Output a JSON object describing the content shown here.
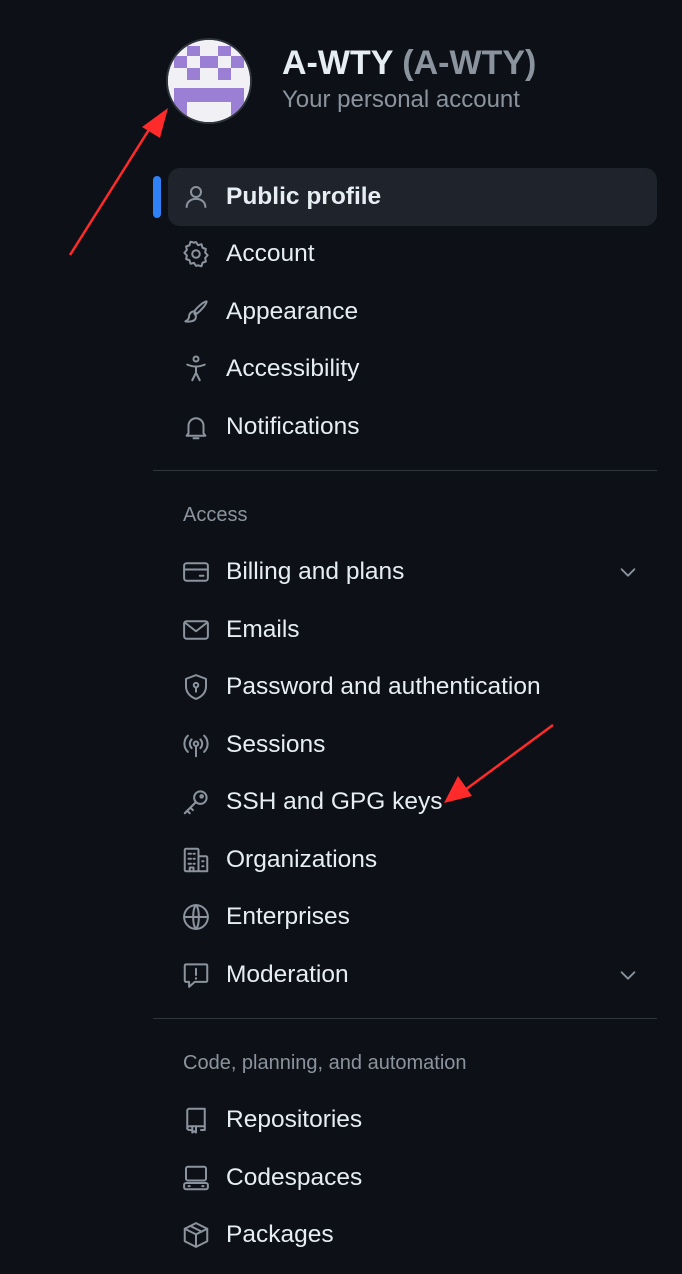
{
  "header": {
    "display_name": "A-WTY",
    "login": "(A-WTY)",
    "subtitle": "Your personal account"
  },
  "nav": {
    "top_items": [
      {
        "label": "Public profile",
        "icon": "person-icon",
        "active": true
      },
      {
        "label": "Account",
        "icon": "gear-icon"
      },
      {
        "label": "Appearance",
        "icon": "paintbrush-icon"
      },
      {
        "label": "Accessibility",
        "icon": "accessibility-icon"
      },
      {
        "label": "Notifications",
        "icon": "bell-icon"
      }
    ],
    "access_heading": "Access",
    "access_items": [
      {
        "label": "Billing and plans",
        "icon": "credit-card-icon",
        "expandable": true
      },
      {
        "label": "Emails",
        "icon": "mail-icon"
      },
      {
        "label": "Password and authentication",
        "icon": "shield-lock-icon"
      },
      {
        "label": "Sessions",
        "icon": "broadcast-icon"
      },
      {
        "label": "SSH and GPG keys",
        "icon": "key-icon"
      },
      {
        "label": "Organizations",
        "icon": "organization-icon"
      },
      {
        "label": "Enterprises",
        "icon": "globe-icon"
      },
      {
        "label": "Moderation",
        "icon": "report-icon",
        "expandable": true
      }
    ],
    "code_heading": "Code, planning, and automation",
    "code_items": [
      {
        "label": "Repositories",
        "icon": "repo-icon"
      },
      {
        "label": "Codespaces",
        "icon": "codespaces-icon"
      },
      {
        "label": "Packages",
        "icon": "package-icon"
      }
    ]
  },
  "colors": {
    "background": "#0d1117",
    "active_bar": "#2f81f7",
    "avatar_purple": "#9b7fd4",
    "annotation_arrow": "#ff2a2a"
  }
}
